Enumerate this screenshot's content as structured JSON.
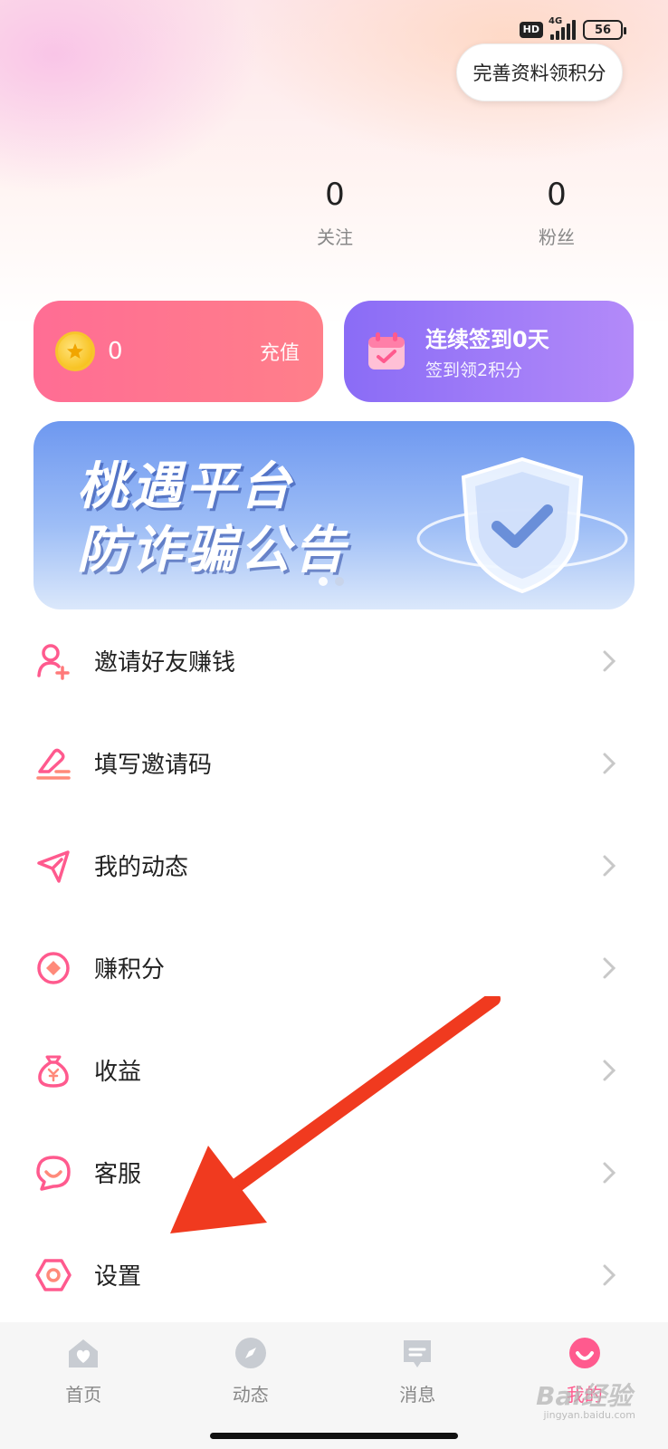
{
  "status": {
    "hd": "HD",
    "network": "4G",
    "battery": "56"
  },
  "header": {
    "complete_profile_label": "完善资料领积分"
  },
  "stats": {
    "follow_count": "0",
    "follow_label": "关注",
    "fans_count": "0",
    "fans_label": "粉丝"
  },
  "coins": {
    "value": "0",
    "recharge_label": "充值"
  },
  "signin": {
    "title": "连续签到0天",
    "subtitle": "签到领2积分"
  },
  "banner": {
    "line1": "桃遇平台",
    "line2": "防诈骗公告"
  },
  "menu": {
    "items": [
      {
        "label": "邀请好友赚钱",
        "icon": "add-user-icon"
      },
      {
        "label": "填写邀请码",
        "icon": "pen-icon"
      },
      {
        "label": "我的动态",
        "icon": "paper-plane-icon"
      },
      {
        "label": "赚积分",
        "icon": "coin-target-icon"
      },
      {
        "label": "收益",
        "icon": "money-bag-icon"
      },
      {
        "label": "客服",
        "icon": "customer-service-icon"
      },
      {
        "label": "设置",
        "icon": "settings-hex-icon"
      }
    ]
  },
  "tabbar": {
    "tabs": [
      {
        "label": "首页",
        "icon": "home-icon"
      },
      {
        "label": "动态",
        "icon": "compass-icon"
      },
      {
        "label": "消息",
        "icon": "message-icon"
      },
      {
        "label": "我的",
        "icon": "profile-icon"
      }
    ],
    "active_index": 3
  },
  "watermark": {
    "brand": "Bai经验",
    "url": "jingyan.baidu.com"
  },
  "colors": {
    "accent": "#ff5a8e",
    "coin_card": "#ff6d94",
    "sign_card": "#8a6cf6",
    "arrow": "#f03a1f"
  }
}
